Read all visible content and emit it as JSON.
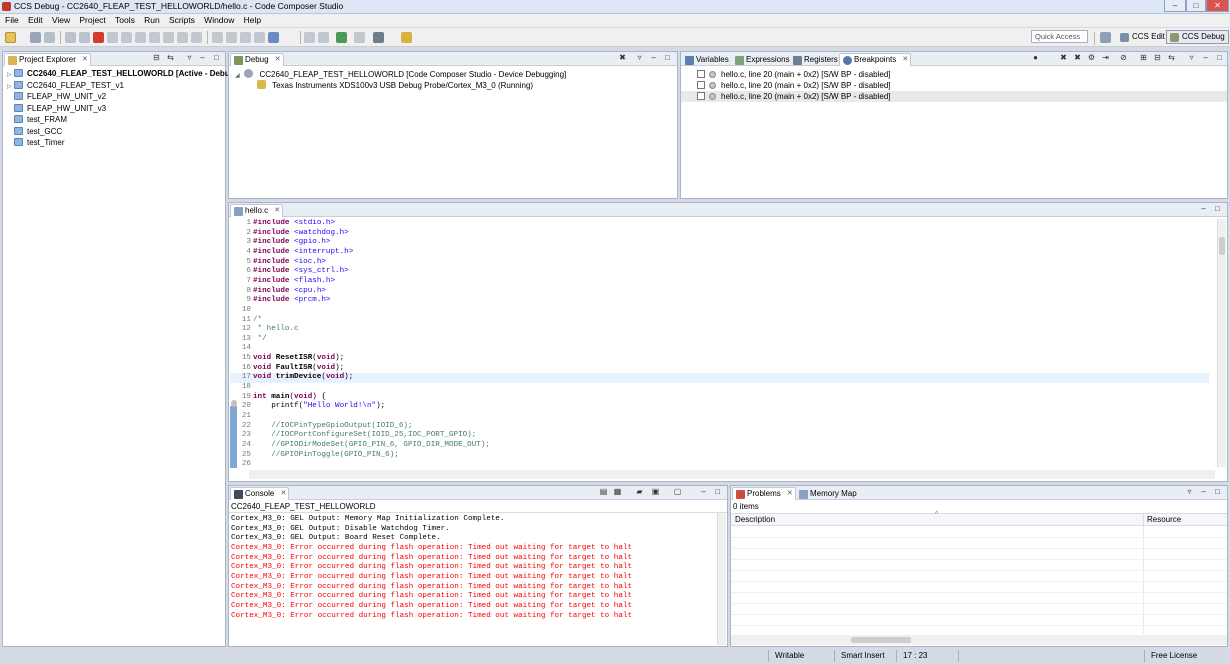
{
  "window": {
    "title": "CCS Debug - CC2640_FLEAP_TEST_HELLOWORLD/hello.c - Code Composer Studio",
    "controls": [
      "–",
      "□",
      "✕"
    ]
  },
  "menu": [
    "File",
    "Edit",
    "View",
    "Project",
    "Tools",
    "Run",
    "Scripts",
    "Window",
    "Help"
  ],
  "toolbar": {
    "quick_access": "Quick Access",
    "perspectives": [
      {
        "label": "CCS Edit",
        "active": false
      },
      {
        "label": "CCS Debug",
        "active": true
      }
    ]
  },
  "project_explorer": {
    "tab": "Project Explorer",
    "items": [
      {
        "label": "CC2640_FLEAP_TEST_HELLOWORLD  [Active - Debug]",
        "bold": true,
        "expandable": true
      },
      {
        "label": "CC2640_FLEAP_TEST_v1",
        "bold": false,
        "expandable": true
      },
      {
        "label": "FLEAP_HW_UNIT_v2",
        "bold": false,
        "expandable": false
      },
      {
        "label": "FLEAP_HW_UNIT_v3",
        "bold": false,
        "expandable": false
      },
      {
        "label": "test_FRAM",
        "bold": false,
        "expandable": false
      },
      {
        "label": "test_GCC",
        "bold": false,
        "expandable": false
      },
      {
        "label": "test_Timer",
        "bold": false,
        "expandable": false
      }
    ]
  },
  "debug": {
    "tab": "Debug",
    "session": "CC2640_FLEAP_TEST_HELLOWORLD [Code Composer Studio - Device Debugging]",
    "target": "Texas Instruments XDS100v3 USB Debug Probe/Cortex_M3_0 (Running)"
  },
  "breakpoints_view": {
    "tabs": [
      "Variables",
      "Expressions",
      "Registers",
      "Breakpoints"
    ],
    "active_tab": "Breakpoints",
    "rows": [
      "hello.c, line 20 (main + 0x2)  [S/W BP - disabled]",
      "hello.c, line 20 (main + 0x2)  [S/W BP - disabled]",
      "hello.c, line 20 (main + 0x2)  [S/W BP - disabled]"
    ]
  },
  "editor": {
    "tab": "hello.c",
    "lines": [
      {
        "n": "1",
        "t": "#include <stdio.h>",
        "k": "inc"
      },
      {
        "n": "2",
        "t": "#include <watchdog.h>",
        "k": "inc"
      },
      {
        "n": "3",
        "t": "#include <gpio.h>",
        "k": "inc"
      },
      {
        "n": "4",
        "t": "#include <interrupt.h>",
        "k": "inc"
      },
      {
        "n": "5",
        "t": "#include <ioc.h>",
        "k": "inc"
      },
      {
        "n": "6",
        "t": "#include <sys_ctrl.h>",
        "k": "inc"
      },
      {
        "n": "7",
        "t": "#include <flash.h>",
        "k": "inc"
      },
      {
        "n": "8",
        "t": "#include <cpu.h>",
        "k": "inc"
      },
      {
        "n": "9",
        "t": "#include <prcm.h>",
        "k": "inc"
      },
      {
        "n": "10",
        "t": "",
        "k": "plain"
      },
      {
        "n": "11",
        "t": "/*",
        "k": "cmt"
      },
      {
        "n": "12",
        "t": " * hello.c",
        "k": "cmt"
      },
      {
        "n": "13",
        "t": " */",
        "k": "cmt"
      },
      {
        "n": "14",
        "t": "",
        "k": "plain"
      },
      {
        "n": "15",
        "t": "void ResetISR(void);",
        "k": "decl"
      },
      {
        "n": "16",
        "t": "void FaultISR(void);",
        "k": "decl"
      },
      {
        "n": "17",
        "t": "void trimDevice(void);",
        "k": "decl",
        "highlight": true
      },
      {
        "n": "18",
        "t": "",
        "k": "plain"
      },
      {
        "n": "19",
        "t": "int main(void) {",
        "k": "decl"
      },
      {
        "n": "20",
        "t": "    printf(\"Hello World!\\n\");",
        "k": "call"
      },
      {
        "n": "21",
        "t": "",
        "k": "plain"
      },
      {
        "n": "22",
        "t": "    //IOCPinTypeGpioOutput(IOID_6);",
        "k": "cmt"
      },
      {
        "n": "23",
        "t": "    //IOCPortConfigureSet(IOID_25,IOC_PORT_GPIO);",
        "k": "cmt"
      },
      {
        "n": "24",
        "t": "    //GPIODirModeSet(GPIO_PIN_6, GPIO_DIR_MODE_OUT);",
        "k": "cmt"
      },
      {
        "n": "25",
        "t": "    //GPIOPinToggle(GPIO_PIN_6);",
        "k": "cmt"
      },
      {
        "n": "26",
        "t": "",
        "k": "plain"
      }
    ]
  },
  "console": {
    "tab": "Console",
    "context": "CC2640_FLEAP_TEST_HELLOWORLD",
    "lines": [
      {
        "t": "Cortex_M3_0: GEL Output: Memory Map Initialization Complete.",
        "error": false
      },
      {
        "t": "Cortex_M3_0: GEL Output: Disable Watchdog Timer.",
        "error": false
      },
      {
        "t": "Cortex_M3_0: GEL Output: Board Reset Complete.",
        "error": false
      },
      {
        "t": "Cortex_M3_0: Error occurred during flash operation: Timed out waiting for target to halt",
        "error": true
      },
      {
        "t": "Cortex_M3_0: Error occurred during flash operation: Timed out waiting for target to halt",
        "error": true
      },
      {
        "t": "Cortex_M3_0: Error occurred during flash operation: Timed out waiting for target to halt",
        "error": true
      },
      {
        "t": "Cortex_M3_0: Error occurred during flash operation: Timed out waiting for target to halt",
        "error": true
      },
      {
        "t": "Cortex_M3_0: Error occurred during flash operation: Timed out waiting for target to halt",
        "error": true
      },
      {
        "t": "Cortex_M3_0: Error occurred during flash operation: Timed out waiting for target to halt",
        "error": true
      },
      {
        "t": "Cortex_M3_0: Error occurred during flash operation: Timed out waiting for target to halt",
        "error": true
      },
      {
        "t": "Cortex_M3_0: Error occurred during flash operation: Timed out waiting for target to halt",
        "error": true
      }
    ]
  },
  "problems": {
    "tabs": [
      "Problems",
      "Memory Map"
    ],
    "count": "0 items",
    "columns": [
      "Description",
      "Resource"
    ]
  },
  "status": {
    "writable": "Writable",
    "insert_mode": "Smart Insert",
    "position": "17 : 23",
    "license": "Free License"
  }
}
